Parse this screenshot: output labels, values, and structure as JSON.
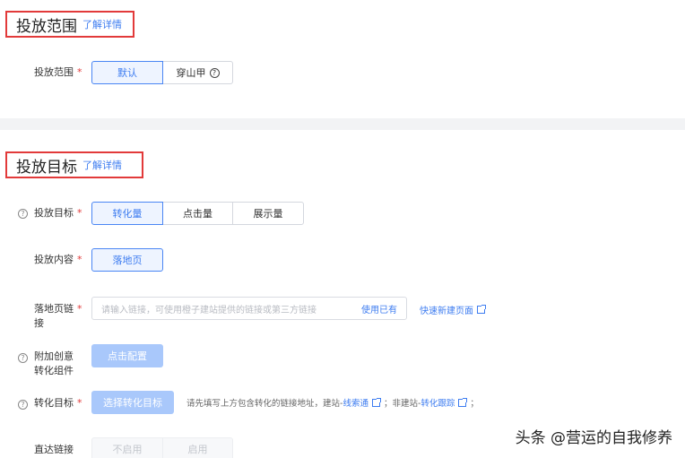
{
  "section1": {
    "title": "投放范围",
    "detail_link": "了解详情",
    "field_label": "投放范围",
    "required_mark": "*",
    "options": [
      "默认",
      "穿山甲"
    ],
    "help_glyph": "?"
  },
  "section2": {
    "title": "投放目标",
    "detail_link": "了解详情",
    "goal": {
      "label": "投放目标",
      "options": [
        "转化量",
        "点击量",
        "展示量"
      ]
    },
    "content": {
      "label": "投放内容",
      "option": "落地页"
    },
    "landing": {
      "label_line1": "落地页链",
      "label_line2": "接",
      "placeholder": "请输入链接，可使用橙子建站提供的链接或第三方链接",
      "use_existing": "使用已有",
      "quick_create": "快速新建页面"
    },
    "component": {
      "label_line1": "附加创意",
      "label_line2": "转化组件",
      "button": "点击配置"
    },
    "conversion": {
      "label": "转化目标",
      "button": "选择转化目标",
      "hint_prefix": "请先填写上方包含转化的链接地址，建站-",
      "hint_link1": "线索通",
      "hint_mid": "；非建站-",
      "hint_link2": "转化跟踪",
      "hint_suffix": "；"
    },
    "direct": {
      "label": "直达链接",
      "options": [
        "不启用",
        "启用"
      ]
    },
    "required_mark": "*",
    "help_glyph": "?"
  },
  "watermark": "头条 @营运的自我修养",
  "colors": {
    "accent": "#3d7cf0",
    "required": "#e23a3a",
    "highlight_box": "#e23a3a"
  }
}
